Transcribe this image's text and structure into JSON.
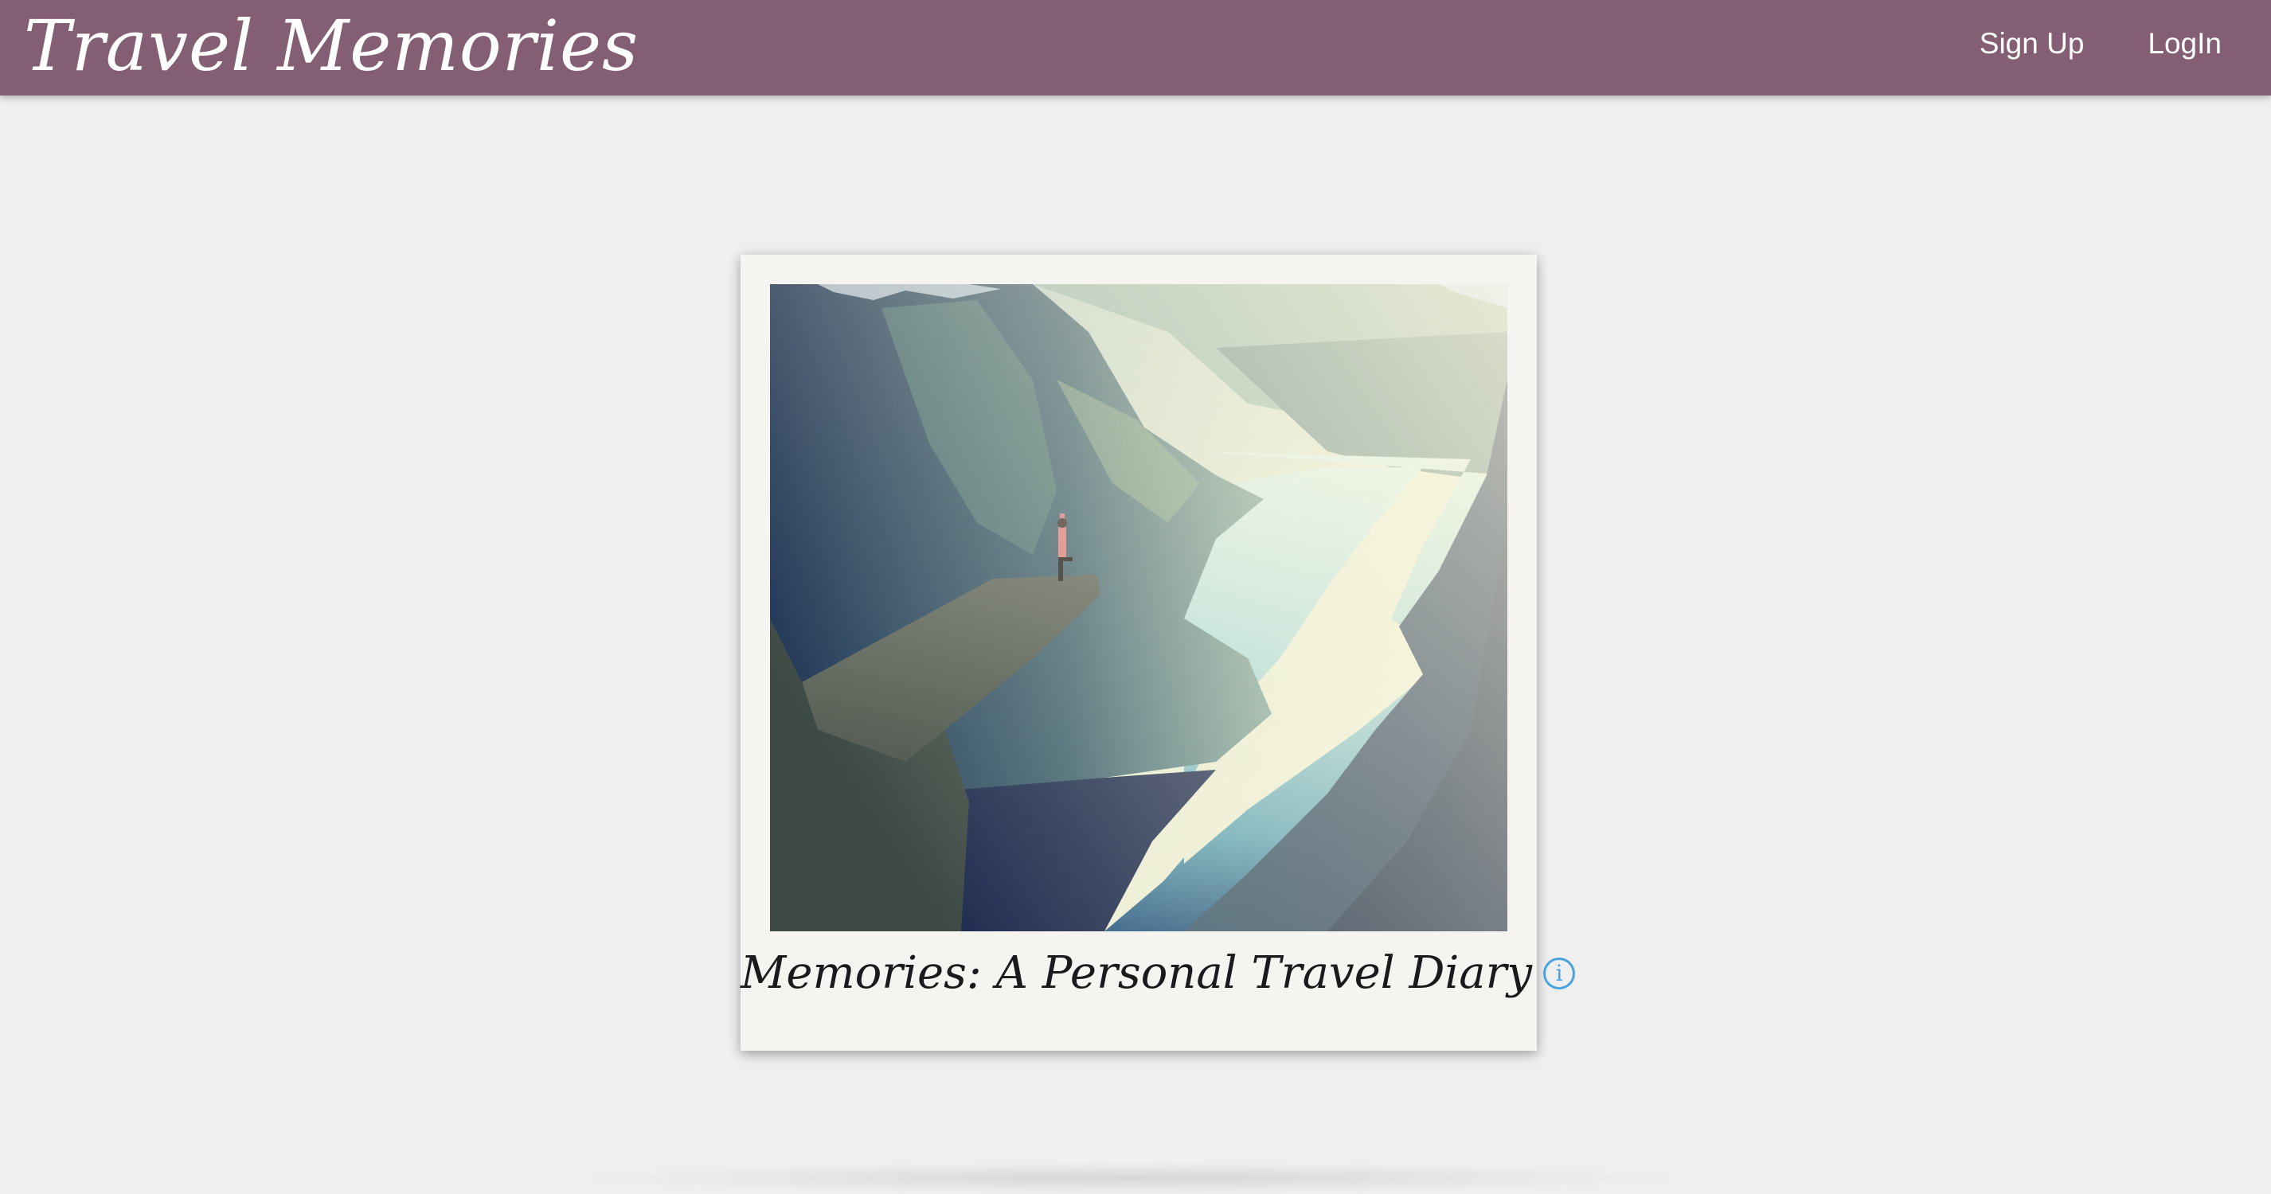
{
  "navbar": {
    "brand": "Travel Memories",
    "links": [
      {
        "label": "Sign Up"
      },
      {
        "label": "LogIn"
      }
    ],
    "background_color": "#845f73"
  },
  "hero_card": {
    "image_subject": "hiker standing on a rock ledge above a fjord",
    "caption": "Memories: A Personal Travel Diary",
    "info_icon": "info-icon",
    "info_color": "#4aa3df"
  }
}
